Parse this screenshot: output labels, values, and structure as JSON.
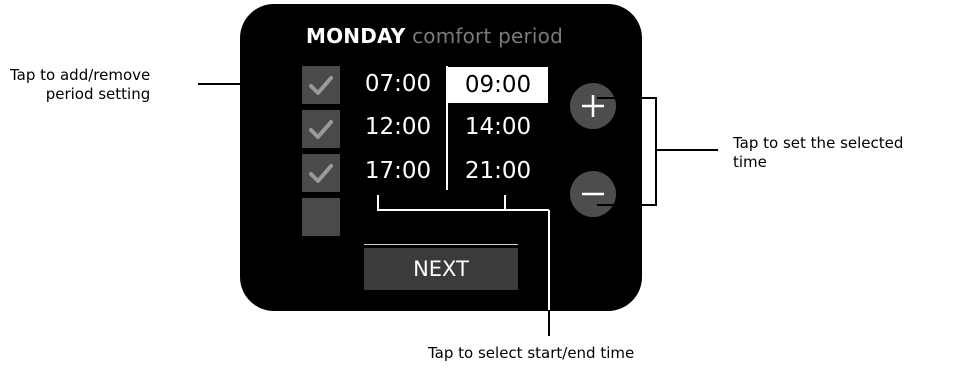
{
  "screen": {
    "title_day": "MONDAY",
    "title_sub": "comfort period",
    "periods": [
      {
        "checked": true,
        "start": "07:00",
        "end": "09:00",
        "end_selected": true
      },
      {
        "checked": true,
        "start": "12:00",
        "end": "14:00",
        "end_selected": false
      },
      {
        "checked": true,
        "start": "17:00",
        "end": "21:00",
        "end_selected": false
      },
      {
        "checked": false
      }
    ],
    "next_label": "NEXT",
    "plus_icon": "plus-icon",
    "minus_icon": "minus-icon"
  },
  "annotations": {
    "left_line1": "Tap to add/remove",
    "left_line2": "period setting",
    "right_line1": "Tap to set the selected",
    "right_line2": "time",
    "bottom": "Tap to select start/end time"
  },
  "colors": {
    "screen_bg": "#000000",
    "checkbox_bg": "#4a4a4a",
    "check_mark": "#9a9a9a",
    "subtitle": "#7b7b7b",
    "circle_button": "#4d4d4d",
    "next_bg": "#3b3b3b"
  }
}
